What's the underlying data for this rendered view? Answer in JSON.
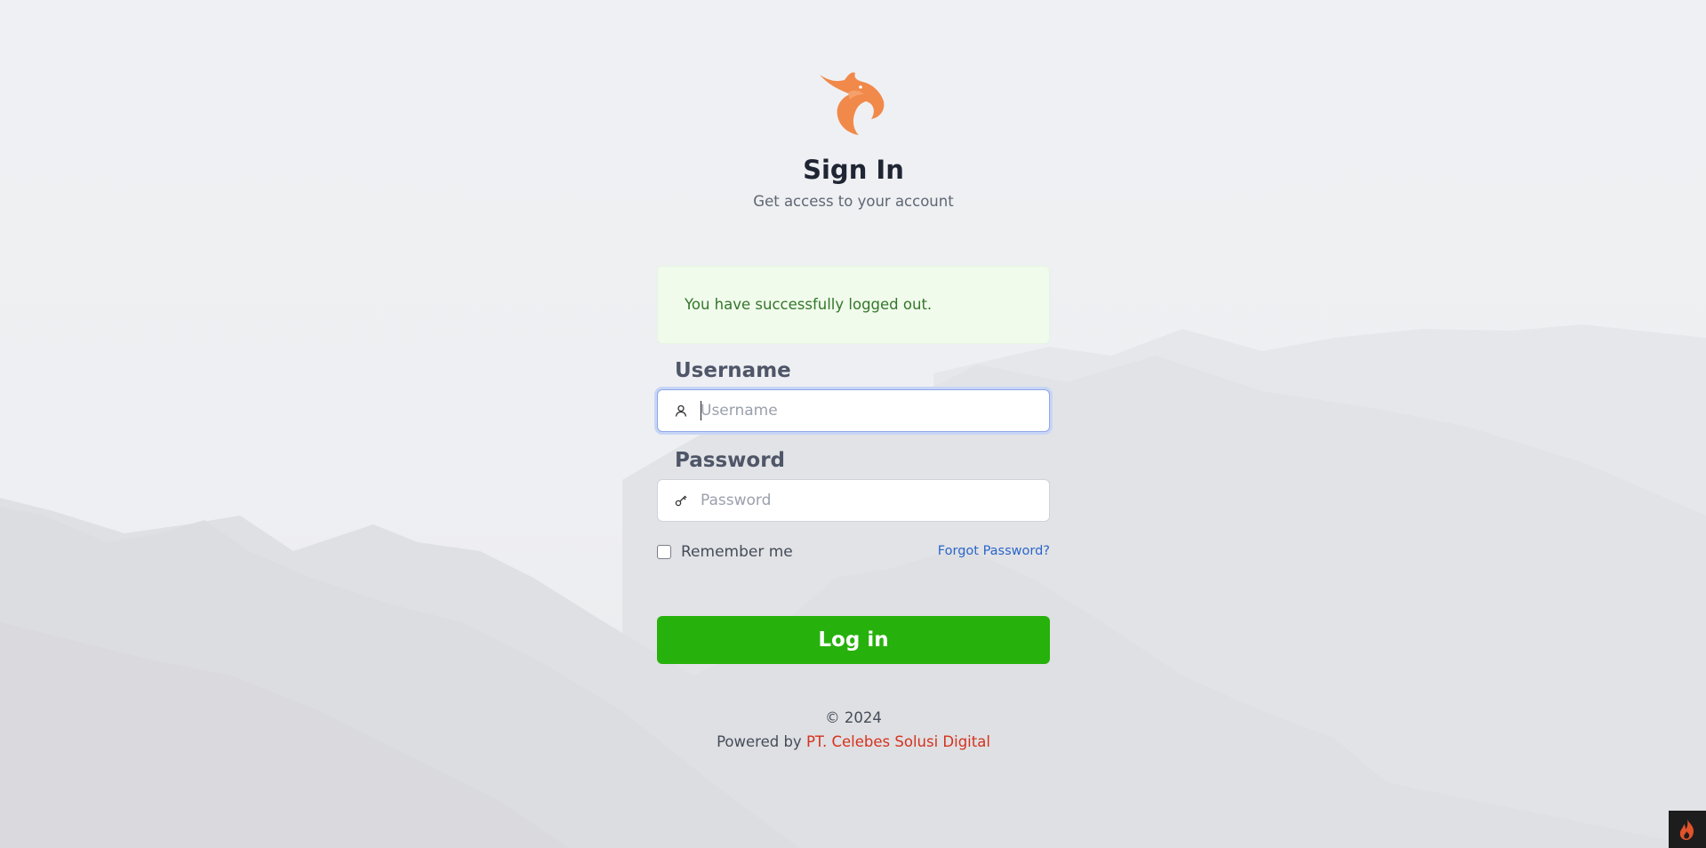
{
  "brand": {
    "logo_icon": "phoenix-logo-icon",
    "logo_color": "#f0894a"
  },
  "heading": {
    "title": "Sign In",
    "subtitle": "Get access to your account"
  },
  "alert": {
    "message": "You have successfully logged out.",
    "color": "#34762a",
    "background": "#f0fbec"
  },
  "form": {
    "username": {
      "label": "Username",
      "placeholder": "Username",
      "value": "",
      "icon": "user-icon",
      "focused": true
    },
    "password": {
      "label": "Password",
      "placeholder": "Password",
      "value": "",
      "icon": "key-icon"
    },
    "remember_me": {
      "label": "Remember me",
      "checked": false
    },
    "forgot_password": "Forgot Password?",
    "submit_label": "Log in",
    "submit_color": "#27b10c"
  },
  "footer": {
    "copyright": "© 2024",
    "powered_by_prefix": "Powered by ",
    "powered_by_link": "PT. Celebes Solusi Digital",
    "link_color": "#d4321e"
  },
  "corner_widget": {
    "icon": "flame-icon"
  }
}
